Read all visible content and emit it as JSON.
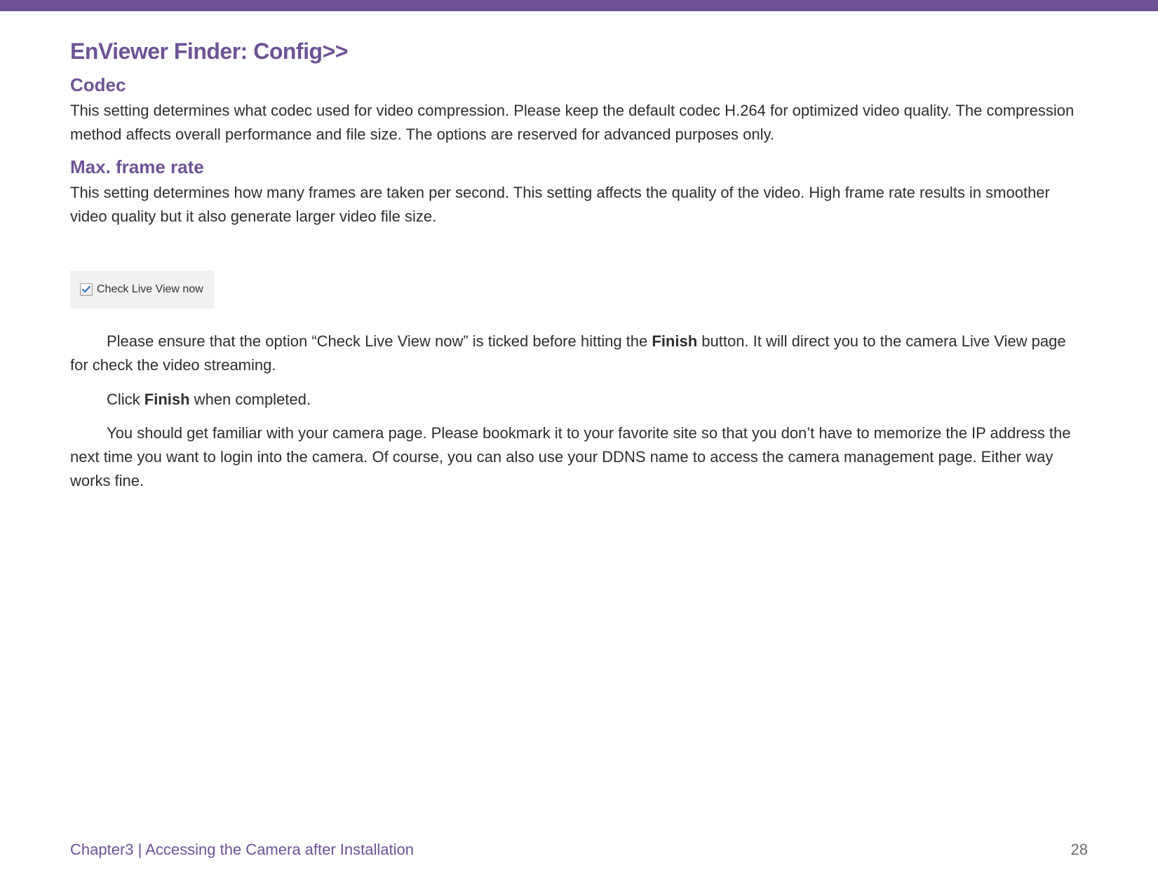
{
  "header": {
    "title": "EnViewer Finder: Config>>"
  },
  "sections": {
    "codec": {
      "heading": "Codec",
      "body": "This setting determines what codec used for video compression. Please keep the default codec H.264 for optimized video quality. The compression method affects overall performance and file size. The options are reserved for advanced purposes only."
    },
    "max_frame_rate": {
      "heading": "Max. frame rate",
      "body": "This setting determines how many frames are taken per second. This setting affects the quality of the video. High frame rate results in smoother video quality but it also generate larger video file size."
    }
  },
  "checkbox": {
    "label": "Check Live View now",
    "checked": true
  },
  "paragraphs": {
    "p1_pre": "Please ensure that the option “Check Live View now” is ticked before hitting the ",
    "p1_bold": "Finish",
    "p1_post": " button.  It will direct you to the camera Live View page for check the video streaming.",
    "p2_pre": "Click ",
    "p2_bold": "Finish",
    "p2_post": " when completed.",
    "p3": "You should get familiar with your camera page. Please bookmark it to your favorite site so that you don’t have to memorize the IP address the next time you want to login into the camera. Of course, you can also use your DDNS name to access the camera management page. Either way works fine."
  },
  "footer": {
    "left": "Chapter3  |  Accessing the Camera after Installation",
    "page_number": "28"
  }
}
